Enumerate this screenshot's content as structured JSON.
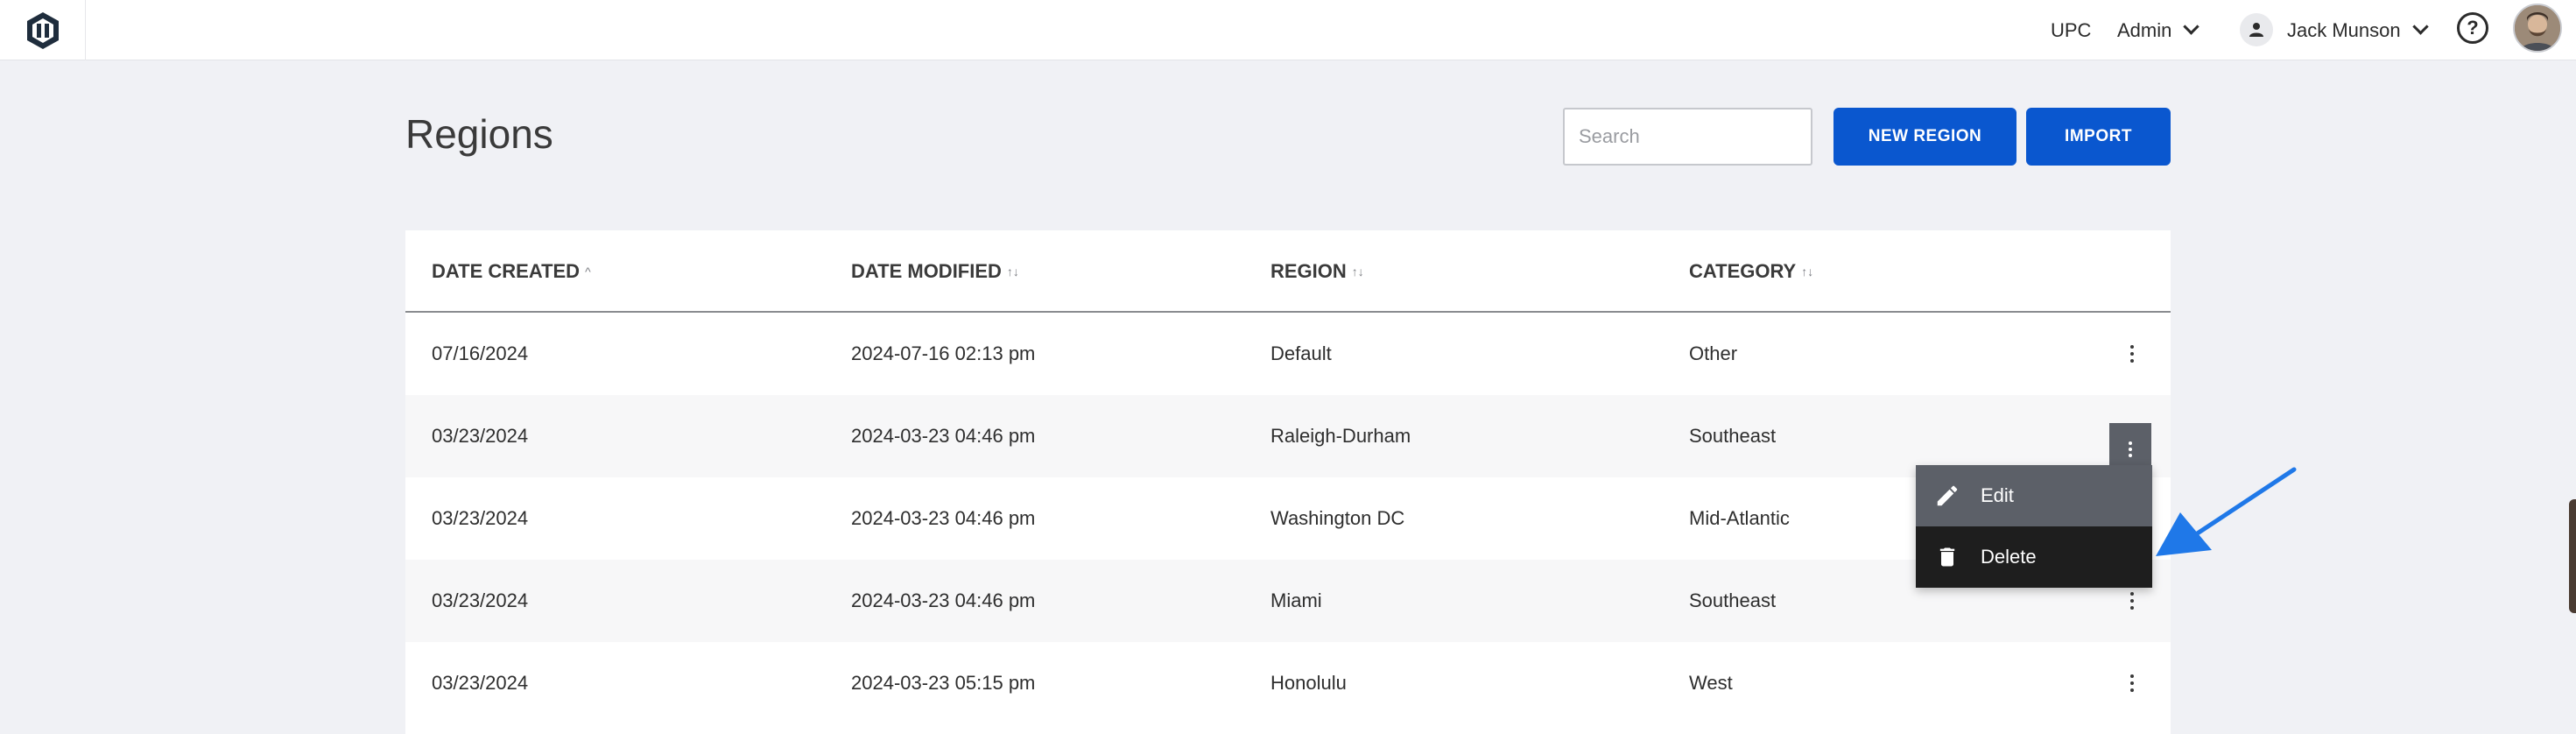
{
  "topbar": {
    "logo_icon": "app-logo-icon",
    "org": "UPC",
    "role": "Admin",
    "user_name": "Jack Munson",
    "user_icon": "person-icon",
    "help_icon": "help-circle-icon",
    "avatar": "user-avatar"
  },
  "page": {
    "title": "Regions",
    "search_placeholder": "Search",
    "search_value": "",
    "new_button": "NEW REGION",
    "import_button": "IMPORT"
  },
  "table": {
    "columns": [
      {
        "label": "DATE CREATED",
        "sort": "^"
      },
      {
        "label": "DATE MODIFIED",
        "sort": "↑↓"
      },
      {
        "label": "REGION",
        "sort": "↑↓"
      },
      {
        "label": "CATEGORY",
        "sort": "↑↓"
      }
    ],
    "rows": [
      {
        "created": "07/16/2024",
        "modified": "2024-07-16 02:13 pm",
        "region": "Default",
        "category": "Other"
      },
      {
        "created": "03/23/2024",
        "modified": "2024-03-23 04:46 pm",
        "region": "Raleigh-Durham",
        "category": "Southeast"
      },
      {
        "created": "03/23/2024",
        "modified": "2024-03-23 04:46 pm",
        "region": "Washington DC",
        "category": "Mid-Atlantic"
      },
      {
        "created": "03/23/2024",
        "modified": "2024-03-23 04:46 pm",
        "region": "Miami",
        "category": "Southeast"
      },
      {
        "created": "03/23/2024",
        "modified": "2024-03-23 05:15 pm",
        "region": "Honolulu",
        "category": "West"
      }
    ]
  },
  "context_menu": {
    "items": [
      {
        "label": "Edit",
        "icon": "pencil-icon",
        "bg": "#5c6068"
      },
      {
        "label": "Delete",
        "icon": "trash-icon",
        "bg": "#1e1e1e"
      }
    ]
  },
  "colors": {
    "accent": "#0a57cf",
    "annotation_arrow": "#1f78e8"
  }
}
